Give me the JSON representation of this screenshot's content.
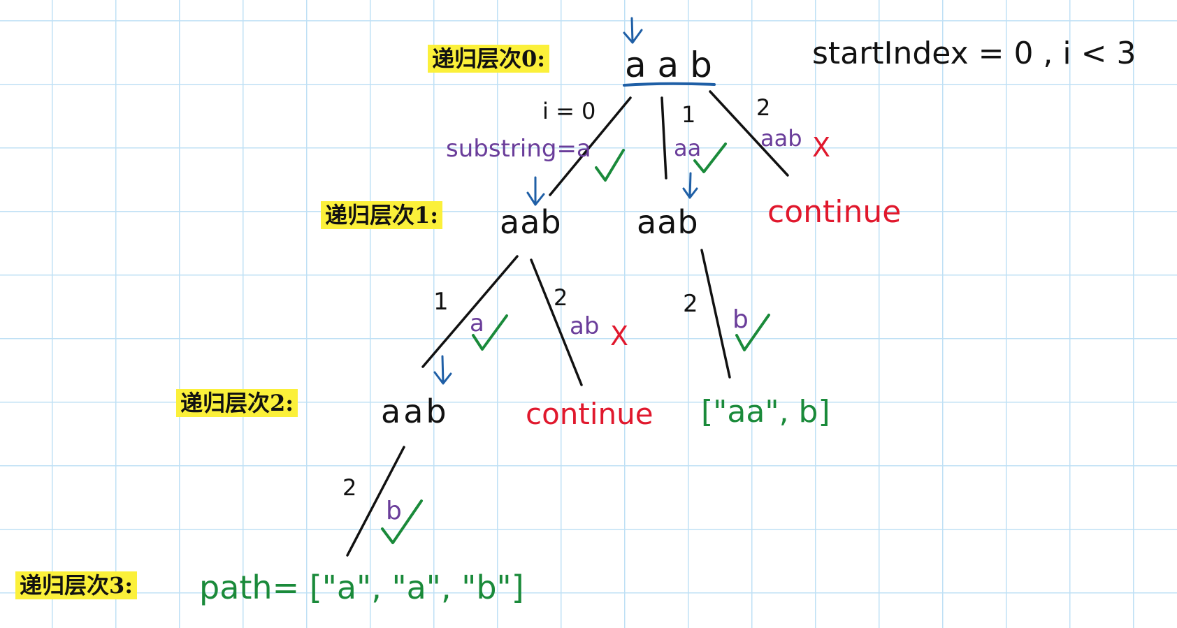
{
  "levels": {
    "l0": "递归层次0:",
    "l1": "递归层次1:",
    "l2": "递归层次2:",
    "l3": "递归层次3:"
  },
  "nodes": {
    "root": "a a b",
    "l1_left": "aab",
    "l1_right": "aab",
    "l2_left": "aab"
  },
  "header_note": "startIndex = 0 , i < 3",
  "edges": {
    "root_left_index": "i = 0",
    "root_left_sub": "substring=a",
    "root_mid_index": "1",
    "root_mid_sub": "aa",
    "root_right_index": "2",
    "root_right_sub": "aab",
    "l1a_left_index": "1",
    "l1a_left_sub": "a",
    "l1a_right_index": "2",
    "l1a_right_sub": "ab",
    "l1b_index": "2",
    "l1b_sub": "b",
    "l2_index": "2",
    "l2_sub": "b"
  },
  "marks": {
    "cross": "X",
    "check_icon": "check-icon",
    "arrow_icon": "down-arrow-icon"
  },
  "outcomes": {
    "continue_1": "continue",
    "continue_2": "continue",
    "result_1": "[\"aa\", b]",
    "path": "path= [\"a\", \"a\", \"b\"]"
  },
  "colors": {
    "grid": "#bfe0f5",
    "highlight": "#fbf03a",
    "ink": "#111111",
    "substring": "#6a3d9a",
    "prune": "#e0182d",
    "valid": "#1a8a3a",
    "arrow": "#1f5fa6"
  }
}
